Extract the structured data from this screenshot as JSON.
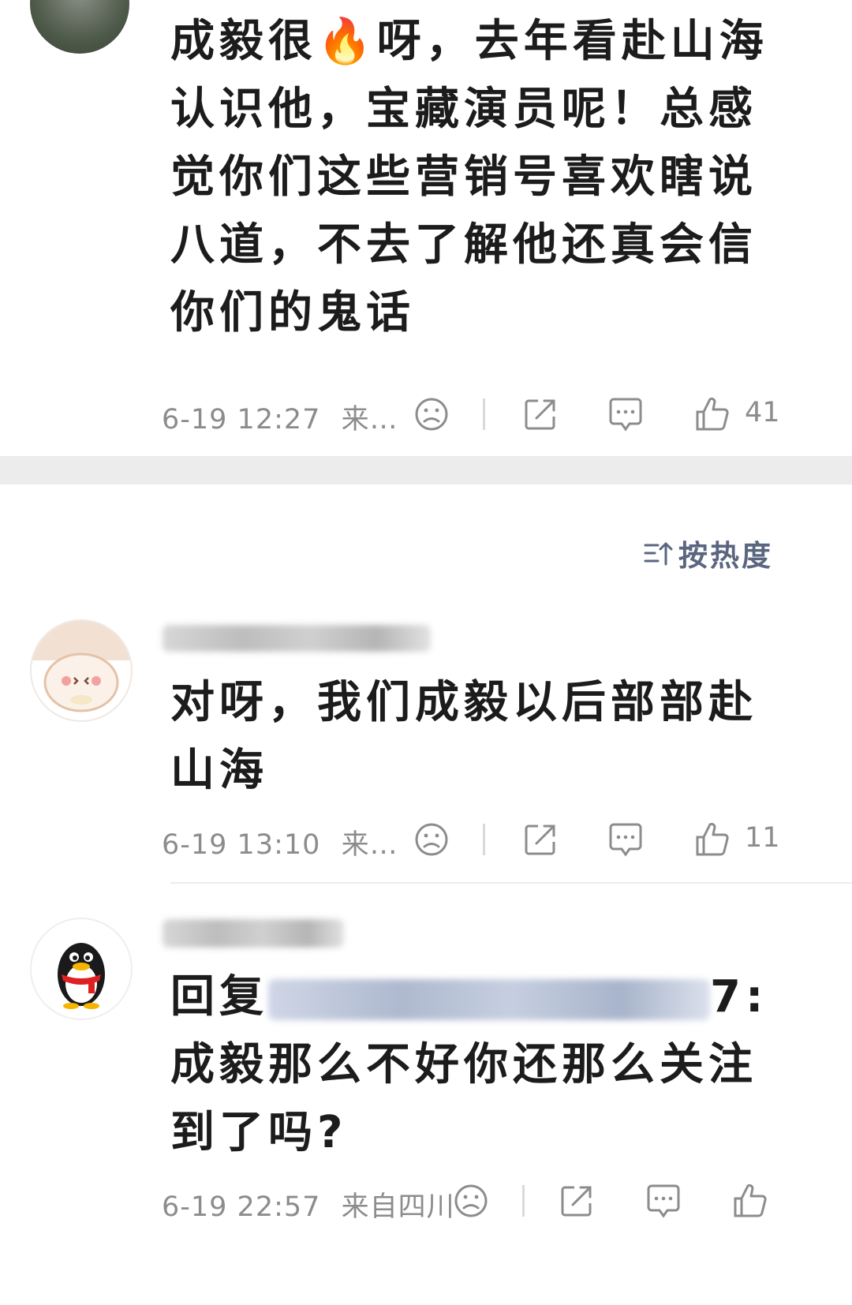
{
  "comments": [
    {
      "text": "成毅很🔥呀，去年看赴山海认识他，宝藏演员呢！总感觉你们这些营销号喜欢瞎说八道，不去了解他还真会信你们的鬼话",
      "time": "6-19 12:27",
      "source": "来…",
      "likes": "41"
    },
    {
      "text": "对呀，我们成毅以后部部赴山海",
      "time": "6-19 13:10",
      "source": "来…",
      "likes": "11"
    },
    {
      "reply_prefix": "回复",
      "reply_suffix": "7:",
      "text": "成毅那么不好你还那么关注到了吗?",
      "time": "6-19 22:57",
      "source": "来自四川"
    }
  ],
  "sort": {
    "label": "按热度"
  },
  "icons": {
    "dislike": "sad-face-icon",
    "share": "share-icon",
    "reply": "comment-bubble-icon",
    "like": "thumbs-up-icon",
    "sort": "sort-icon"
  }
}
